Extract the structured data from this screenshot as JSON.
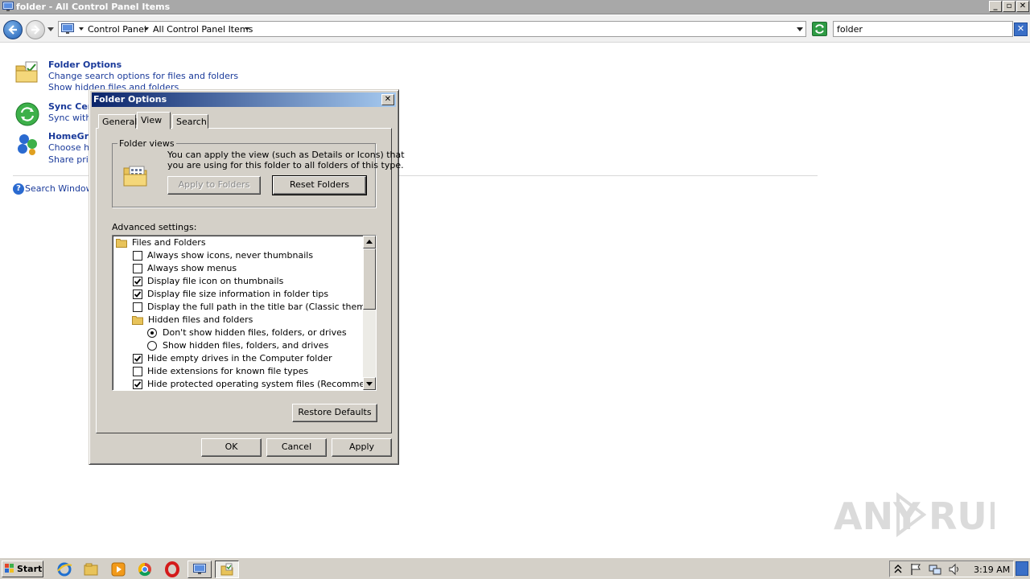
{
  "window": {
    "title": "folder - All Control Panel Items",
    "minimize_label": "_",
    "maximize_label": "▫",
    "close_label": "✕"
  },
  "address": {
    "breadcrumbs": [
      "Control Panel",
      "All Control Panel Items"
    ],
    "search_value": "folder",
    "search_clear_label": "✕"
  },
  "results": [
    {
      "title": "Folder Options",
      "lines": [
        "Change search options for files and folders",
        "Show hidden files and folders"
      ],
      "icon": "folder-options-icon"
    },
    {
      "title": "Sync Cen",
      "lines": [
        "Sync with"
      ],
      "icon": "sync-center-icon"
    },
    {
      "title": "HomeGro",
      "lines": [
        "Choose ho",
        "Share prin"
      ],
      "icon": "homegroup-icon"
    }
  ],
  "search_help": {
    "text": "Search Windows",
    "icon_label": "?"
  },
  "dialog": {
    "title": "Folder Options",
    "close_label": "✕",
    "tabs": [
      "General",
      "View",
      "Search"
    ],
    "active_tab": "View",
    "folder_views": {
      "legend": "Folder views",
      "description_line1": "You can apply the view (such as Details or Icons) that",
      "description_line2": "you are using for this folder to all folders of this type.",
      "apply_button": "Apply to Folders",
      "reset_button": "Reset Folders"
    },
    "advanced_label": "Advanced settings:",
    "advanced_items": [
      {
        "type": "folder",
        "label": "Files and Folders"
      },
      {
        "type": "checkbox",
        "label": "Always show icons, never thumbnails",
        "checked": false
      },
      {
        "type": "checkbox",
        "label": "Always show menus",
        "checked": false
      },
      {
        "type": "checkbox",
        "label": "Display file icon on thumbnails",
        "checked": true
      },
      {
        "type": "checkbox",
        "label": "Display file size information in folder tips",
        "checked": true
      },
      {
        "type": "checkbox",
        "label": "Display the full path in the title bar (Classic theme only)",
        "checked": false
      },
      {
        "type": "folder",
        "label": "Hidden files and folders"
      },
      {
        "type": "radio",
        "label": "Don't show hidden files, folders, or drives",
        "checked": true
      },
      {
        "type": "radio",
        "label": "Show hidden files, folders, and drives",
        "checked": false
      },
      {
        "type": "checkbox",
        "label": "Hide empty drives in the Computer folder",
        "checked": true
      },
      {
        "type": "checkbox",
        "label": "Hide extensions for known file types",
        "checked": false
      },
      {
        "type": "checkbox",
        "label": "Hide protected operating system files (Recommended)",
        "checked": true
      }
    ],
    "restore_defaults": "Restore Defaults",
    "ok": "OK",
    "cancel": "Cancel",
    "apply": "Apply"
  },
  "taskbar": {
    "start_label": "Start",
    "clock": "3:19 AM",
    "pinned_icons": [
      "internet-explorer-icon",
      "explorer-icon",
      "media-player-icon",
      "chrome-icon",
      "opera-icon"
    ]
  },
  "watermark": {
    "text": "ANY RUN"
  }
}
